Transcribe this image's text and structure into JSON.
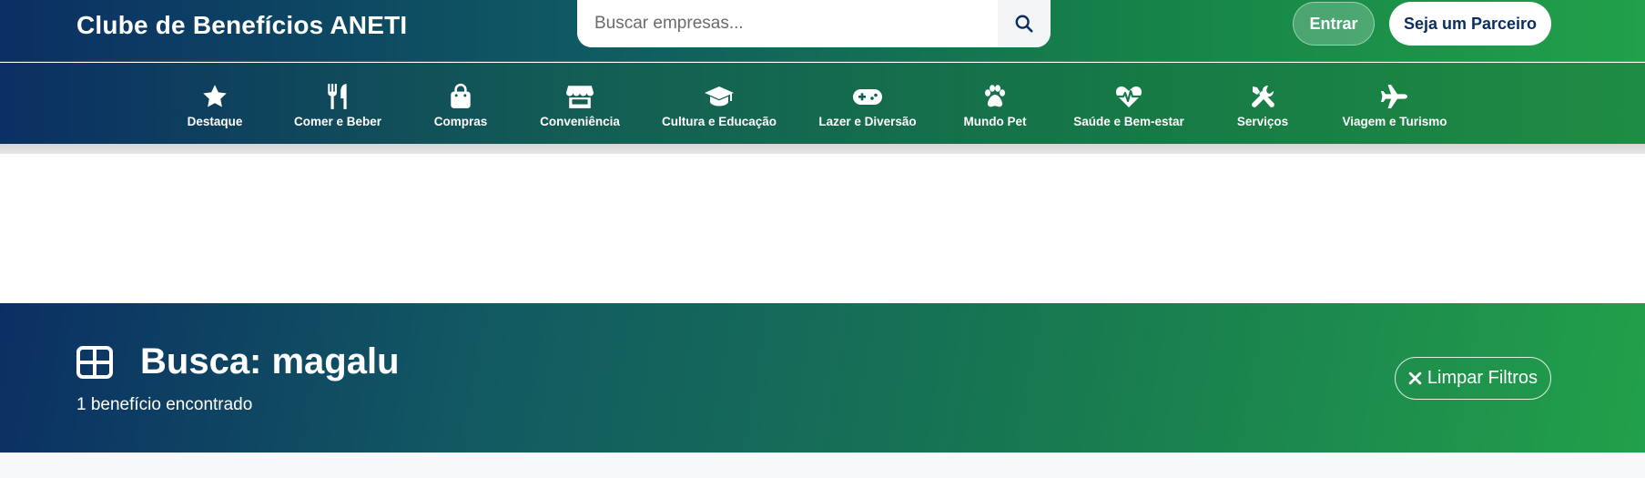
{
  "header": {
    "brand": "Clube de Benefícios ANETI",
    "search_placeholder": "Buscar empresas...",
    "login_label": "Entrar",
    "partner_label": "Seja um Parceiro"
  },
  "categories": [
    {
      "label": "Destaque",
      "icon": "star-icon"
    },
    {
      "label": "Comer e Beber",
      "icon": "utensils-icon"
    },
    {
      "label": "Compras",
      "icon": "shopping-bag-icon"
    },
    {
      "label": "Conveniência",
      "icon": "store-icon"
    },
    {
      "label": "Cultura e Educação",
      "icon": "graduation-cap-icon"
    },
    {
      "label": "Lazer e Diversão",
      "icon": "gamepad-icon"
    },
    {
      "label": "Mundo Pet",
      "icon": "paw-icon"
    },
    {
      "label": "Saúde e Bem-estar",
      "icon": "heart-pulse-icon"
    },
    {
      "label": "Serviços",
      "icon": "tools-icon"
    },
    {
      "label": "Viagem e Turismo",
      "icon": "plane-icon"
    }
  ],
  "results": {
    "title": "Busca: magalu",
    "count_text": "1 benefício encontrado",
    "clear_label": "Limpar Filtros",
    "title_icon": "grid-icon"
  },
  "colors": {
    "navy": "#0b2f63",
    "green": "#22a04a"
  }
}
